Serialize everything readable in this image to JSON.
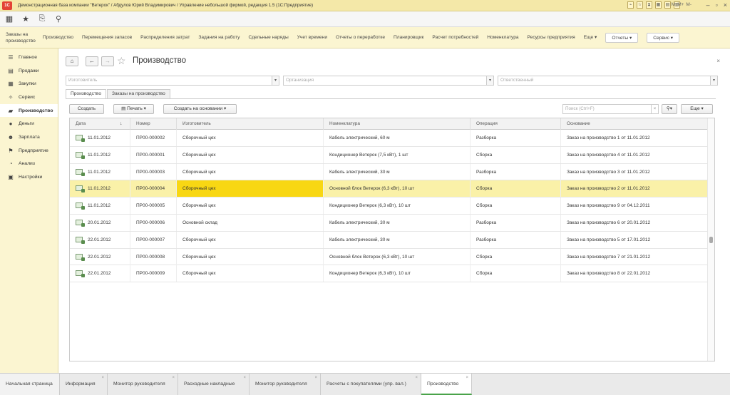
{
  "titlebar": {
    "title": "Демонстрационная база компании \"Ветерок\" / Абдулов Юрий Владимирович / Управление небольшой фирмой, редакция 1.5 (1С:Предприятие)",
    "m_buttons": [
      "M",
      "M+",
      "M-"
    ]
  },
  "iconbar": {
    "icons": [
      "apps-grid-icon",
      "favorites-star-icon",
      "history-icon",
      "search-icon"
    ]
  },
  "topmenu": {
    "items": [
      "Заказы на производство",
      "Производство",
      "Перемещения запасов",
      "Распределения затрат",
      "Задания на работу",
      "Сдельные наряды",
      "Учет времени",
      "Отчеты о переработке",
      "Планировщик",
      "Расчет потребностей",
      "Номенклатура",
      "Ресурсы предприятия"
    ],
    "more": "Еще",
    "reports": "Отчеты",
    "service": "Сервис"
  },
  "sidebar": {
    "items": [
      {
        "label": "Главное",
        "icon": "☰"
      },
      {
        "label": "Продажи",
        "icon": "▤"
      },
      {
        "label": "Закупки",
        "icon": "▦"
      },
      {
        "label": "Сервис",
        "icon": "✧"
      },
      {
        "label": "Производство",
        "icon": "▰"
      },
      {
        "label": "Деньги",
        "icon": "●"
      },
      {
        "label": "Зарплата",
        "icon": "☻"
      },
      {
        "label": "Предприятие",
        "icon": "⚑"
      },
      {
        "label": "Анализ",
        "icon": "◔"
      },
      {
        "label": "Настройки",
        "icon": "▣"
      }
    ],
    "active_index": 4
  },
  "main": {
    "title": "Производство",
    "close": "×",
    "filters": {
      "manufacturer": "Изготовитель",
      "organization": "Организация",
      "responsible": "Ответственный"
    },
    "tabs": [
      "Производство",
      "Заказы на производство"
    ],
    "commands": {
      "create": "Создать",
      "print": "Печать",
      "create_based_on": "Создать на основании",
      "search_placeholder": "Поиск (Ctrl+F)",
      "more": "Еще"
    },
    "table": {
      "columns": [
        "Дата",
        "Номер",
        "Изготовитель",
        "Номенклатура",
        "Операция",
        "Основание"
      ],
      "rows": [
        {
          "date": "11.01.2012",
          "number": "ПР00-000002",
          "maker": "Сборочный цех",
          "item": "Кабель электрический, 60 м",
          "op": "Разборка",
          "basis": "Заказ на производство 1 от 11.01.2012"
        },
        {
          "date": "11.01.2012",
          "number": "ПР00-000001",
          "maker": "Сборочный цех",
          "item": "Кондиционер Ветерок (7,5 кВт), 1 шт",
          "op": "Сборка",
          "basis": "Заказ на производство 4 от 11.01.2012"
        },
        {
          "date": "11.01.2012",
          "number": "ПР00-000003",
          "maker": "Сборочный цех",
          "item": "Кабель электрический, 30 м",
          "op": "Разборка",
          "basis": "Заказ на производство 3 от 11.01.2012"
        },
        {
          "date": "11.01.2012",
          "number": "ПР00-000004",
          "maker": "Сборочный цех",
          "item": "Основной блок Ветерок (6,3 кВт), 10 шт",
          "op": "Сборка",
          "basis": "Заказ на производство 2 от 11.01.2012"
        },
        {
          "date": "11.01.2012",
          "number": "ПР00-000005",
          "maker": "Сборочный цех",
          "item": "Кондиционер Ветерок (6,3 кВт), 10 шт",
          "op": "Сборка",
          "basis": "Заказ на производство 9 от 04.12.2011"
        },
        {
          "date": "20.01.2012",
          "number": "ПР00-000006",
          "maker": "Основной склад",
          "item": "Кабель электрический, 30 м",
          "op": "Разборка",
          "basis": "Заказ на производство 6 от 20.01.2012"
        },
        {
          "date": "22.01.2012",
          "number": "ПР00-000007",
          "maker": "Сборочный цех",
          "item": "Кабель электрический, 30 м",
          "op": "Разборка",
          "basis": "Заказ на производство 5 от 17.01.2012"
        },
        {
          "date": "22.01.2012",
          "number": "ПР00-000008",
          "maker": "Сборочный цех",
          "item": "Основной блок Ветерок (6,3 кВт), 10 шт",
          "op": "Сборка",
          "basis": "Заказ на производство 7 от 21.01.2012"
        },
        {
          "date": "22.01.2012",
          "number": "ПР00-000009",
          "maker": "Сборочный цех",
          "item": "Кондиционер Ветерок (6,3 кВт), 10 шт",
          "op": "Сборка",
          "basis": "Заказ на производство 8 от 22.01.2012"
        }
      ],
      "selected_index": 3
    }
  },
  "bottom_tabs": [
    "Начальная страница",
    "Информация",
    "Монитор руководителя",
    "Расходные накладные",
    "Монитор руководителя",
    "Расчеты с покупателями (упр. вал.)",
    "Производство"
  ],
  "colors": {
    "accent_yellow": "#fbf5d1",
    "selected_row": "#faf1a8",
    "selected_cell": "#f8d713",
    "active_tab_underline": "#4aa34a"
  }
}
